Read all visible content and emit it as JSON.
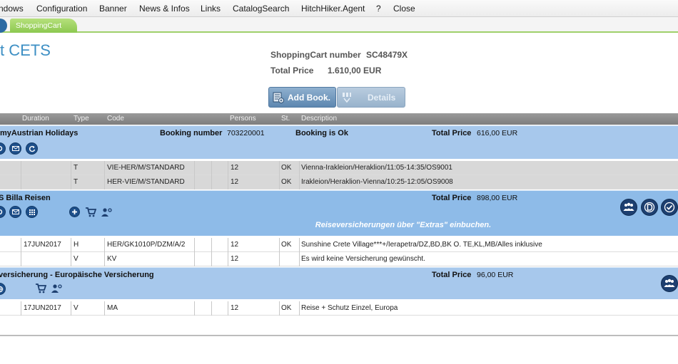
{
  "menu": {
    "items": [
      "ndows",
      "Configuration",
      "Banner",
      "News & Infos",
      "Links",
      "CatalogSearch",
      "HitchHiker.Agent",
      "?",
      "Close"
    ]
  },
  "tabs": {
    "active": "ShoppingCart"
  },
  "header": {
    "app_title": "t CETS",
    "cart_label": "ShoppingCart number",
    "cart_number": "SC48479X",
    "total_label": "Total Price",
    "total_value": "1.610,00 EUR"
  },
  "buttons": {
    "add_book": "Add Book.",
    "details": "Details"
  },
  "columns": [
    "Duration",
    "Type",
    "Code",
    "Persons",
    "St.",
    "Description"
  ],
  "groups": [
    {
      "title": "myAustrian Holidays",
      "booking_label": "Booking number",
      "booking_number": "703220001",
      "status": "Booking is Ok",
      "total_label": "Total Price",
      "total_value": "616,00 EUR",
      "rows": [
        {
          "date": "",
          "type": "T",
          "code": "VIE-HER/M/STANDARD",
          "persons": "12",
          "st": "OK",
          "desc": "Vienna-Irakleion/Heraklion/11:05-14:35/OS9001"
        },
        {
          "date": "",
          "type": "T",
          "code": "HER-VIE/M/STANDARD",
          "persons": "12",
          "st": "OK",
          "desc": "Irakleion/Heraklion-Vienna/10:25-12:05/OS9008"
        }
      ]
    },
    {
      "title": "S Billa Reisen",
      "total_label": "Total Price",
      "total_value": "898,00 EUR",
      "notice": "Reiseversicherungen über \"Extras\" einbuchen.",
      "rows": [
        {
          "date": "17JUN2017",
          "type": "H",
          "code": "HER/GK1010P/DZM/A/2",
          "persons": "12",
          "st": "OK",
          "desc": "Sunshine Crete Village***+/Ierapetra/DZ,BD,BK O. TE,KL,MB/Alles inklusive"
        },
        {
          "date": "",
          "type": "V",
          "code": "KV",
          "persons": "12",
          "st": "",
          "desc": "Es wird keine Versicherung gewünscht."
        }
      ]
    },
    {
      "title": "versicherung - Europäische Versicherung",
      "total_label": "Total Price",
      "total_value": "96,00 EUR",
      "rows": [
        {
          "date": "17JUN2017",
          "type": "V",
          "code": "MA",
          "persons": "12",
          "st": "OK",
          "desc": "Reise + Schutz Einzel, Europa"
        }
      ]
    }
  ],
  "colors": {
    "accent": "#3d8fc4",
    "group_bg": "#a7c8ec",
    "group_bg_dark": "#8ebbe8",
    "tab": "#8cc850",
    "icon": "#1d4f8a"
  },
  "icons": [
    "add-book-icon",
    "details-icon",
    "info-icon",
    "mail-icon",
    "refresh-icon",
    "grid-icon",
    "plus-icon",
    "cart-icon",
    "person-add-icon",
    "group-icon",
    "d-icon",
    "check-icon",
    "globe-icon"
  ]
}
